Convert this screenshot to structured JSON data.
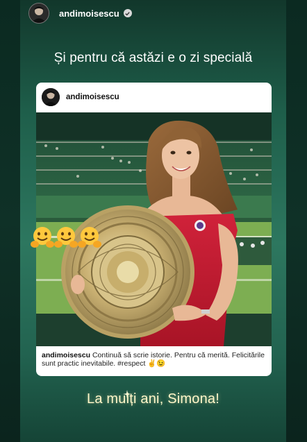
{
  "story": {
    "header": {
      "username": "andimoisescu",
      "avatar_icon": "profile-avatar",
      "verified_icon": "verified-badge-icon"
    },
    "headline": "Și pentru că astăzi e o zi specială",
    "post": {
      "username": "andimoisescu",
      "caption_user": "andimoisescu",
      "caption_text": " Continuă să scrie istorie. Pentru că merită. Felicitările sunt practic inevitabile. #respect ✌️😉"
    },
    "stickers": {
      "emojis": [
        "hugging-face",
        "hugging-face",
        "hugging-face"
      ]
    },
    "signoff": "La mulți ani, Simona!"
  },
  "colors": {
    "background": "#2b705a",
    "signoff_text": "#fff7c9",
    "dress": "#c41a2c"
  }
}
